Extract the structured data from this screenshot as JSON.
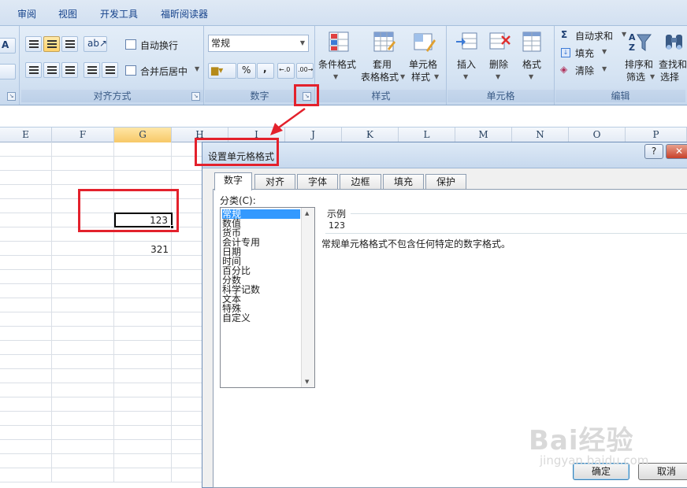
{
  "ribbon_tabs": [
    "审阅",
    "视图",
    "开发工具",
    "福昕阅读器"
  ],
  "ribbon": {
    "partial_left": "A",
    "wrap_text": "自动换行",
    "merge_center": "合并后居中",
    "alignment_group": "对齐方式",
    "number_format_value": "常规",
    "percent": "%",
    "comma": ",",
    "number_group": "数字",
    "conditional_format": "条件格式",
    "format_as_table": [
      "套用",
      "表格格式"
    ],
    "cell_styles": [
      "单元格",
      "样式"
    ],
    "styles_group": "样式",
    "insert": "插入",
    "delete": "删除",
    "format": "格式",
    "cells_group": "单元格",
    "autosum": "自动求和",
    "fill": "填充",
    "clear": "清除",
    "sort_filter": [
      "排序和",
      "筛选"
    ],
    "find_select": [
      "查找和",
      "选择"
    ],
    "editing_group": "编辑"
  },
  "sheet": {
    "columns": [
      "E",
      "F",
      "G",
      "H",
      "I",
      "J",
      "K",
      "L",
      "M",
      "N",
      "O",
      "P"
    ],
    "selected_column": "G",
    "cells": {
      "g_active": "123",
      "g_below": "321"
    }
  },
  "dialog": {
    "title": "设置单元格格式",
    "help": "?",
    "close": "✕",
    "tabs": [
      "数字",
      "对齐",
      "字体",
      "边框",
      "填充",
      "保护"
    ],
    "active_tab": "数字",
    "category_label": "分类(C):",
    "categories": [
      "常规",
      "数值",
      "货币",
      "会计专用",
      "日期",
      "时间",
      "百分比",
      "分数",
      "科学记数",
      "文本",
      "特殊",
      "自定义"
    ],
    "selected_category": "常规",
    "sample_label": "示例",
    "sample_value": "123",
    "description": "常规单元格格式不包含任何特定的数字格式。",
    "ok": "确定",
    "cancel": "取消"
  },
  "watermark": {
    "brand": "Bai经验",
    "url": "jingyan.baidu.com"
  },
  "colors": {
    "annotation_red": "#e3212c",
    "selection_blue": "#3399ff",
    "ribbon_blue": "#d6e4f3"
  }
}
